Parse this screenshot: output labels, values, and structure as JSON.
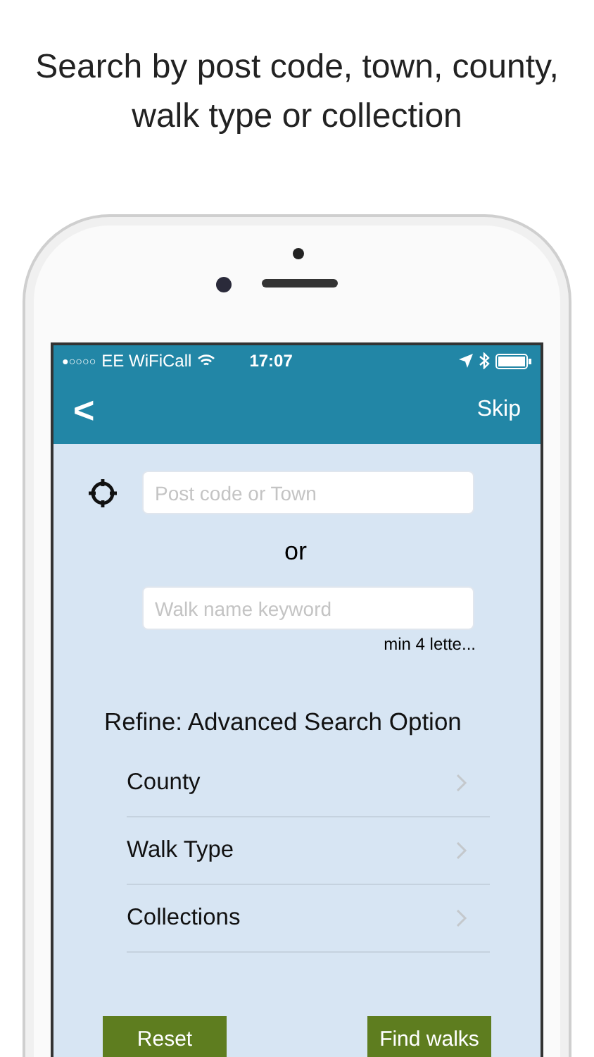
{
  "caption": "Search by post code, town, county, walk type or collection",
  "status_bar": {
    "signal": "●○○○○",
    "carrier": "EE WiFiCall",
    "time": "17:07"
  },
  "nav_bar": {
    "back": "<",
    "action": "Skip"
  },
  "search": {
    "location_placeholder": "Post code or Town",
    "separator": "or",
    "keyword_placeholder": "Walk name keyword",
    "hint": "min 4 lette..."
  },
  "refine": {
    "title": "Refine: Advanced Search Option",
    "items": [
      {
        "label": "County"
      },
      {
        "label": "Walk Type"
      },
      {
        "label": "Collections"
      }
    ]
  },
  "buttons": [
    {
      "label": "Reset"
    },
    {
      "label": "Find walks"
    }
  ]
}
